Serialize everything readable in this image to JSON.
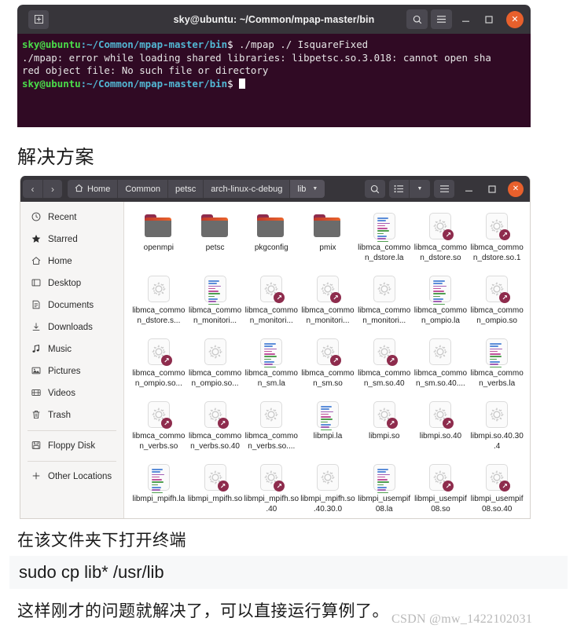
{
  "terminal": {
    "title": "sky@ubuntu: ~/Common/mpap-master/bin",
    "new_tab_icon": "new-tab-icon",
    "search_icon": "search-icon",
    "menu_icon": "hamburger-menu-icon",
    "minimize_icon": "minimize-icon",
    "maximize_icon": "maximize-icon",
    "close_icon": "close-icon",
    "lines": [
      {
        "prompt_user": "sky@ubuntu",
        "prompt_path": ":~/Common/mpap-master/bin",
        "prompt_sym": "$ ",
        "command": "./mpap ./ IsquareFixed"
      },
      {
        "output": "./mpap: error while loading shared libraries: libpetsc.so.3.018: cannot open sha"
      },
      {
        "output": "red object file: No such file or directory"
      },
      {
        "prompt_user": "sky@ubuntu",
        "prompt_path": ":~/Common/mpap-master/bin",
        "prompt_sym": "$ ",
        "command": ""
      }
    ]
  },
  "headings": {
    "solution": "解决方案",
    "open_terminal": "在该文件夹下打开终端",
    "command": "sudo cp lib* /usr/lib",
    "final": "这样刚才的问题就解决了，可以直接运行算例了。",
    "watermark": "CSDN @mw_1422102031"
  },
  "filemanager": {
    "nav": {
      "back": "‹",
      "forward": "›"
    },
    "breadcrumbs": [
      {
        "label": "Home",
        "icon": "home-icon",
        "active": false
      },
      {
        "label": "Common",
        "active": false
      },
      {
        "label": "petsc",
        "active": false
      },
      {
        "label": "arch-linux-c-debug",
        "active": false
      },
      {
        "label": "lib",
        "active": true
      }
    ],
    "toolbar": {
      "search_icon": "search-icon",
      "view_list_icon": "view-list-icon",
      "view_dropdown_icon": "chevron-down-icon",
      "menu_icon": "hamburger-menu-icon",
      "minimize_icon": "minimize-icon",
      "maximize_icon": "maximize-icon",
      "close_icon": "close-icon"
    },
    "sidebar": [
      {
        "label": "Recent",
        "icon": "clock-icon"
      },
      {
        "label": "Starred",
        "icon": "star-icon"
      },
      {
        "label": "Home",
        "icon": "home-icon"
      },
      {
        "label": "Desktop",
        "icon": "desktop-icon"
      },
      {
        "label": "Documents",
        "icon": "document-icon"
      },
      {
        "label": "Downloads",
        "icon": "download-icon"
      },
      {
        "label": "Music",
        "icon": "music-note-icon"
      },
      {
        "label": "Pictures",
        "icon": "picture-icon"
      },
      {
        "label": "Videos",
        "icon": "video-icon"
      },
      {
        "label": "Trash",
        "icon": "trash-icon"
      },
      {
        "label": "Floppy Disk",
        "icon": "floppy-disk-icon"
      },
      {
        "label": "Other Locations",
        "icon": "plus-icon"
      }
    ],
    "files": [
      {
        "name": "openmpi",
        "type": "folder"
      },
      {
        "name": "petsc",
        "type": "folder"
      },
      {
        "name": "pkgconfig",
        "type": "folder"
      },
      {
        "name": "pmix",
        "type": "folder"
      },
      {
        "name": "libmca_common_dstore.la",
        "type": "text"
      },
      {
        "name": "libmca_common_dstore.so",
        "type": "symlink"
      },
      {
        "name": "libmca_common_dstore.so.1",
        "type": "symlink"
      },
      {
        "name": "libmca_common_dstore.s...",
        "type": "binary"
      },
      {
        "name": "libmca_common_monitori...",
        "type": "text"
      },
      {
        "name": "libmca_common_monitori...",
        "type": "symlink"
      },
      {
        "name": "libmca_common_monitori...",
        "type": "symlink"
      },
      {
        "name": "libmca_common_monitori...",
        "type": "binary"
      },
      {
        "name": "libmca_common_ompio.la",
        "type": "text"
      },
      {
        "name": "libmca_common_ompio.so",
        "type": "symlink"
      },
      {
        "name": "libmca_common_ompio.so...",
        "type": "symlink"
      },
      {
        "name": "libmca_common_ompio.so...",
        "type": "binary"
      },
      {
        "name": "libmca_common_sm.la",
        "type": "text"
      },
      {
        "name": "libmca_common_sm.so",
        "type": "symlink"
      },
      {
        "name": "libmca_common_sm.so.40",
        "type": "symlink"
      },
      {
        "name": "libmca_common_sm.so.40....",
        "type": "binary"
      },
      {
        "name": "libmca_common_verbs.la",
        "type": "text"
      },
      {
        "name": "libmca_common_verbs.so",
        "type": "symlink"
      },
      {
        "name": "libmca_common_verbs.so.40",
        "type": "symlink"
      },
      {
        "name": "libmca_common_verbs.so....",
        "type": "binary"
      },
      {
        "name": "libmpi.la",
        "type": "text"
      },
      {
        "name": "libmpi.so",
        "type": "symlink"
      },
      {
        "name": "libmpi.so.40",
        "type": "symlink"
      },
      {
        "name": "libmpi.so.40.30.4",
        "type": "binary"
      },
      {
        "name": "libmpi_mpifh.la",
        "type": "text"
      },
      {
        "name": "libmpi_mpifh.so",
        "type": "symlink"
      },
      {
        "name": "libmpi_mpifh.so.40",
        "type": "symlink"
      },
      {
        "name": "libmpi_mpifh.so.40.30.0",
        "type": "binary"
      },
      {
        "name": "libmpi_usempif08.la",
        "type": "text"
      },
      {
        "name": "libmpi_usempif08.so",
        "type": "symlink"
      },
      {
        "name": "libmpi_usempif08.so.40",
        "type": "symlink"
      }
    ]
  },
  "colors": {
    "titlebar": "#37353a",
    "terminal_bg": "#300a24",
    "close_button": "#e8602c",
    "prompt_user": "#4ade4a",
    "prompt_path": "#52b7d4",
    "symlink_badge": "#8e2c4d",
    "sidebar_bg": "#f6f5f4",
    "code_block_bg": "#f7f8f9"
  }
}
